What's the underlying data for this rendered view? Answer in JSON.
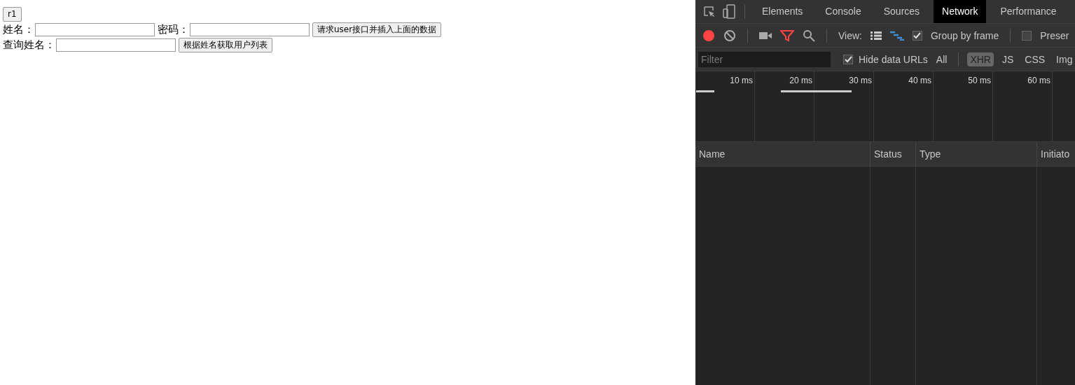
{
  "page": {
    "top_button": "r1",
    "rows": [
      {
        "fields": [
          {
            "label": "姓名："
          },
          {
            "label": "密码："
          }
        ],
        "button": "请求user接口并插入上面的数据"
      },
      {
        "fields": [
          {
            "label": "查询姓名："
          }
        ],
        "button": "根据姓名获取用户列表"
      }
    ]
  },
  "devtools": {
    "tabs": [
      {
        "label": "Elements",
        "selected": false
      },
      {
        "label": "Console",
        "selected": false
      },
      {
        "label": "Sources",
        "selected": false
      },
      {
        "label": "Network",
        "selected": true
      },
      {
        "label": "Performance",
        "selected": false
      }
    ],
    "toolbar": {
      "recording": true,
      "view_label": "View:",
      "group_by_frame": {
        "label": "Group by frame",
        "checked": true
      },
      "preserve": {
        "label": "Preser",
        "checked": false
      }
    },
    "filter": {
      "placeholder": "Filter",
      "hide_data_urls": {
        "label": "Hide data URLs",
        "checked": true
      },
      "types": [
        {
          "label": "All",
          "selected": false
        },
        {
          "label": "XHR",
          "selected": true
        },
        {
          "label": "JS",
          "selected": false
        },
        {
          "label": "CSS",
          "selected": false
        },
        {
          "label": "Img",
          "selected": false
        }
      ]
    },
    "timeline": {
      "ticks": [
        "10 ms",
        "20 ms",
        "30 ms",
        "40 ms",
        "50 ms",
        "60 ms"
      ]
    },
    "columns": [
      "Name",
      "Status",
      "Type",
      "Initiato"
    ]
  }
}
